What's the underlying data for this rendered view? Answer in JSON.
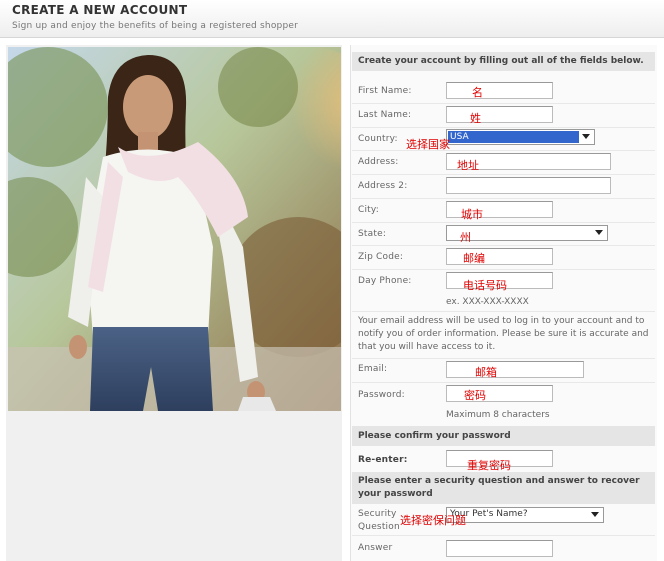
{
  "header": {
    "title": "CREATE A NEW ACCOUNT",
    "subtitle": "Sign up and enjoy the benefits of being a registered shopper"
  },
  "form": {
    "intro": "Create your account by filling out all of the fields below.",
    "first_name": {
      "label": "First Name:",
      "annotation": "名"
    },
    "last_name": {
      "label": "Last Name:",
      "annotation": "姓"
    },
    "country": {
      "label": "Country:",
      "value": "USA",
      "annotation": "选择国家"
    },
    "address": {
      "label": "Address:",
      "annotation": "地址"
    },
    "address2": {
      "label": "Address 2:"
    },
    "city": {
      "label": "City:",
      "annotation": "城市"
    },
    "state": {
      "label": "State:",
      "annotation": "州"
    },
    "zip": {
      "label": "Zip Code:",
      "annotation": "邮编"
    },
    "phone": {
      "label": "Day Phone:",
      "annotation": "电话号码",
      "hint": "ex. XXX-XXX-XXXX"
    },
    "email_note": "Your email address will be used to log in to your account and to notify you of order information. Please be sure it is accurate and that you will have access to it.",
    "email": {
      "label": "Email:",
      "annotation": "邮箱"
    },
    "password": {
      "label": "Password:",
      "annotation": "密码",
      "hint": "Maximum 8 characters"
    },
    "confirm_header": "Please confirm your password",
    "reenter": {
      "label": "Re-enter:",
      "annotation": "重复密码"
    },
    "security_header": "Please enter a security question and answer to recover your password",
    "security_question": {
      "label_line1": "Security",
      "label_line2": "Question",
      "value": "Your Pet's Name?",
      "annotation": "选择密保问题"
    },
    "answer": {
      "label": "Answer"
    }
  },
  "colors": {
    "annotation": "#e00000",
    "select_highlight": "#3366cc"
  }
}
